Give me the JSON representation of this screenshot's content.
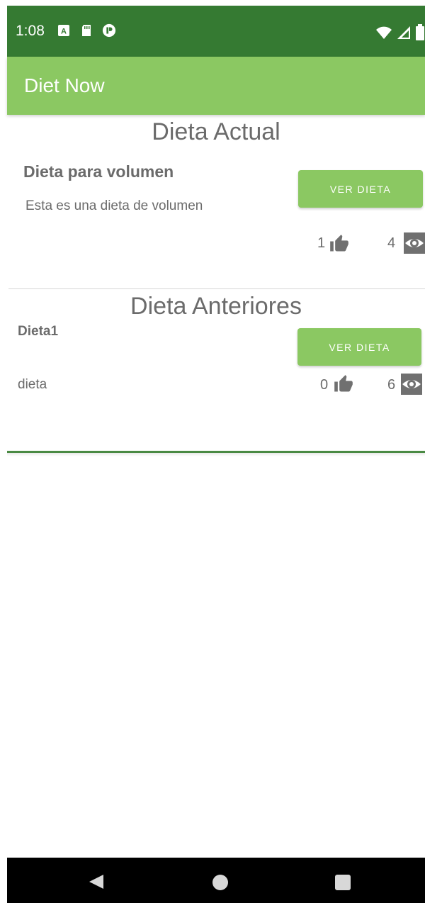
{
  "status_bar": {
    "time": "1:08",
    "icons_left": [
      "a-notification-icon",
      "sd-card-icon",
      "circle-p-icon"
    ],
    "icons_right": [
      "wifi-icon",
      "signal-icon",
      "battery-icon"
    ]
  },
  "app_bar": {
    "title": "Diet Now"
  },
  "current": {
    "section_title": "Dieta Actual",
    "name": "Dieta para volumen",
    "description": "Esta es una dieta de volumen",
    "button_label": "VER DIETA",
    "likes": "1",
    "views": "4"
  },
  "previous": {
    "section_title": "Dieta Anteriores",
    "items": [
      {
        "name": "Dieta1",
        "description": "dieta",
        "button_label": "VER DIETA",
        "likes": "0",
        "views": "6"
      }
    ]
  },
  "nav_bar": {
    "buttons": [
      "back-icon",
      "home-icon",
      "recents-icon"
    ]
  },
  "colors": {
    "status_bar": "#357a32",
    "app_bar": "#8bc862",
    "button": "#8bc862",
    "text_gray": "#6b6b6b",
    "icon_gray": "#707070"
  }
}
